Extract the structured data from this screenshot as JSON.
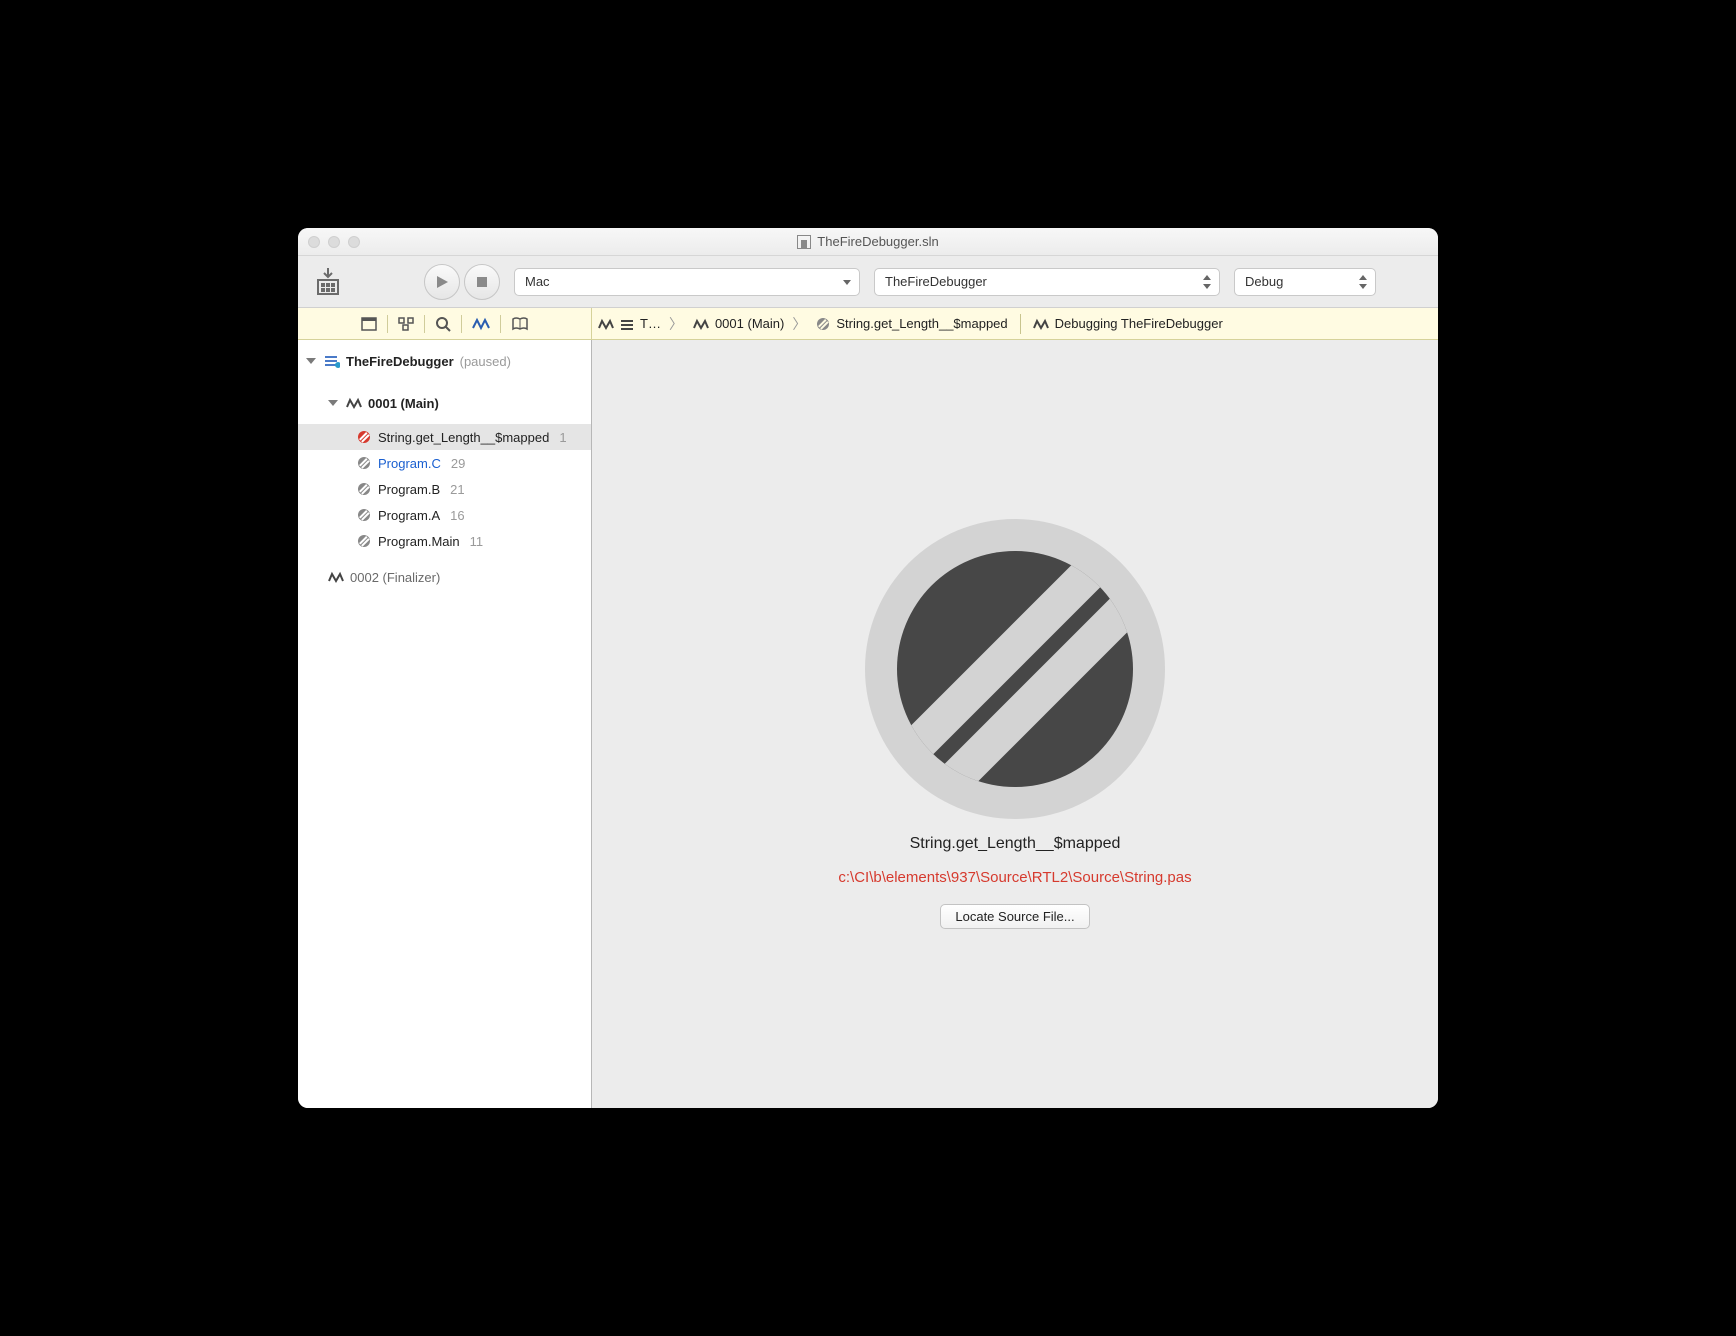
{
  "window": {
    "title": "TheFireDebugger.sln"
  },
  "toolbar": {
    "target": "Mac",
    "project": "TheFireDebugger",
    "config": "Debug"
  },
  "breadcrumb": {
    "b0": "T…",
    "b1": "0001 (Main)",
    "b2": "String.get_Length__$mapped",
    "status": "Debugging TheFireDebugger"
  },
  "tree": {
    "root": {
      "name": "TheFireDebugger",
      "state": "(paused)"
    },
    "thread1": {
      "label": "0001 (Main)"
    },
    "frames": [
      {
        "name": "String.get_Length__$mapped",
        "line": "1",
        "sel": true,
        "red": true
      },
      {
        "name": "Program.C",
        "line": "29",
        "link": true
      },
      {
        "name": "Program.B",
        "line": "21"
      },
      {
        "name": "Program.A",
        "line": "16"
      },
      {
        "name": "Program.Main",
        "line": "11"
      }
    ],
    "thread2": {
      "label": "0002 (Finalizer)"
    }
  },
  "main": {
    "symbol": "String.get_Length__$mapped",
    "path": "c:\\CI\\b\\elements\\937\\Source\\RTL2\\Source\\String.pas",
    "button": "Locate Source File..."
  }
}
